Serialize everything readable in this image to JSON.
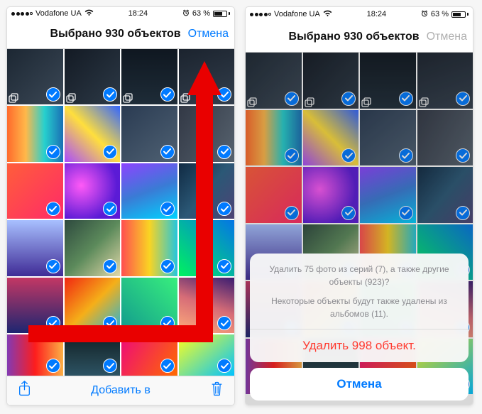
{
  "status": {
    "carrier": "Vodafone UA",
    "time": "18:24",
    "battery_text": "63 %"
  },
  "nav": {
    "title": "Выбрано 930 объектов",
    "cancel": "Отмена"
  },
  "toolbar": {
    "add_to": "Добавить в"
  },
  "sheet": {
    "line1": "Удалить 75 фото из серий (7), а также другие объекты (923)?",
    "line2": "Некоторые объекты будут также удалены из альбомов (11).",
    "destructive": "Удалить 998 объект.",
    "cancel": "Отмена"
  },
  "thumbs_left": {
    "rows": [
      [
        "g1",
        "g2",
        "g3",
        "g4"
      ],
      [
        "g5",
        "g6",
        "g7",
        "g8"
      ],
      [
        "g9",
        "g10",
        "g11",
        "g12"
      ],
      [
        "g13",
        "g14",
        "g15",
        "g16"
      ],
      [
        "g17",
        "g18",
        "g19",
        "g20"
      ],
      [
        "g21",
        "g22",
        "g23",
        "g24"
      ]
    ],
    "burst_cells": [
      [
        0,
        0
      ],
      [
        0,
        1
      ],
      [
        0,
        2
      ],
      [
        0,
        3
      ]
    ]
  },
  "thumbs_right": {
    "rows": [
      [
        "g1",
        "g2",
        "g3",
        "g4"
      ],
      [
        "g5",
        "g6",
        "g7",
        "g8"
      ],
      [
        "g9",
        "g10",
        "g11",
        "g12"
      ],
      [
        "g13",
        "g14",
        "g15",
        "g16"
      ],
      [
        "g17",
        "g18",
        "g19",
        "g20"
      ],
      [
        "g21",
        "g22",
        "g23",
        "g24"
      ]
    ],
    "burst_cells": [
      [
        0,
        0
      ],
      [
        0,
        1
      ],
      [
        0,
        2
      ],
      [
        0,
        3
      ]
    ]
  },
  "colors": {
    "accent": "#007aff",
    "destructive": "#ff3b30",
    "arrow": "#e90000"
  }
}
